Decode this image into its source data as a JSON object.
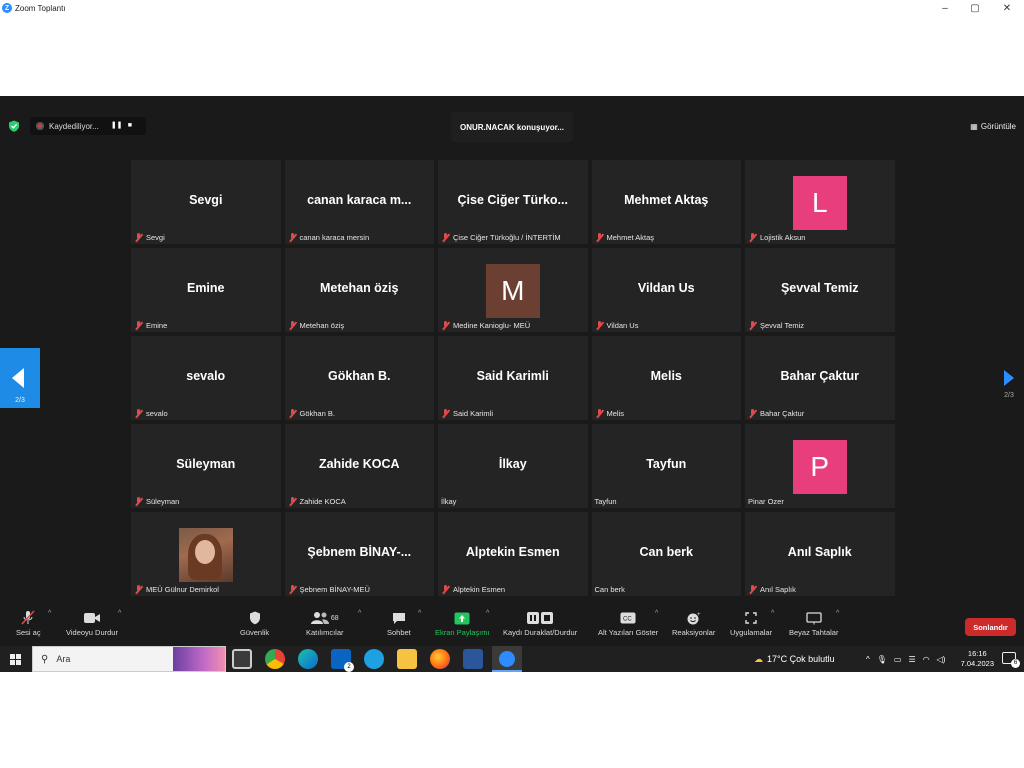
{
  "window": {
    "title": "Zoom Toplantı",
    "controls": [
      "–",
      "▢",
      "✕"
    ]
  },
  "topbar": {
    "recording_label": "Kaydediliyor...",
    "speaker": "ONUR.NACAK konuşuyor...",
    "view_label": "Görüntüle"
  },
  "pagination": {
    "prev_page_label": "2/3",
    "next_page_label": "2/3"
  },
  "participants": [
    {
      "display": "Sevgi",
      "label": "Sevgi",
      "muted": true
    },
    {
      "display": "canan karaca m...",
      "label": "canan karaca mersin",
      "muted": true
    },
    {
      "display": "Çise Ciğer Türko...",
      "label": "Çise Ciğer Türkoğlu / İNTERTİM",
      "muted": true
    },
    {
      "display": "Mehmet Aktaş",
      "label": "Mehmet Aktaş",
      "muted": true
    },
    {
      "display": "L",
      "avatar_color": "#e83e7d",
      "label": "Lojistik Aksun",
      "muted": true
    },
    {
      "display": "Emine",
      "label": "Emine",
      "muted": true
    },
    {
      "display": "Metehan öziş",
      "label": "Metehan öziş",
      "muted": true
    },
    {
      "display": "M",
      "avatar_color": "#6b3f31",
      "label": "Medine Kanioglu- MEÜ",
      "muted": true
    },
    {
      "display": "Vildan Us",
      "label": "Vildan Us",
      "muted": true
    },
    {
      "display": "Şevval Temiz",
      "label": "Şevval Temiz",
      "muted": true
    },
    {
      "display": "sevalo",
      "label": "sevalo",
      "muted": true
    },
    {
      "display": "Gökhan B.",
      "label": "Gökhan B.",
      "muted": true
    },
    {
      "display": "Said Karimli",
      "label": "Said Karimli",
      "muted": true
    },
    {
      "display": "Melis",
      "label": "Melis",
      "muted": true
    },
    {
      "display": "Bahar Çaktur",
      "label": "Bahar Çaktur",
      "muted": true
    },
    {
      "display": "Süleyman",
      "label": "Süleyman",
      "muted": true
    },
    {
      "display": "Zahide KOCA",
      "label": "Zahide KOCA",
      "muted": true
    },
    {
      "display": "İlkay",
      "label": "İlkay",
      "muted": false
    },
    {
      "display": "Tayfun",
      "label": "Tayfun",
      "muted": false
    },
    {
      "display": "P",
      "avatar_color": "#e83e7d",
      "label": "Pinar Ozer",
      "muted": false
    },
    {
      "photo": true,
      "display": "",
      "label": "MEÜ Gülnur Demirkol",
      "muted": true
    },
    {
      "display": "Şebnem BİNAY-...",
      "label": "Şebnem BİNAY-MEÜ",
      "muted": true
    },
    {
      "display": "Alptekin Esmen",
      "label": "Alptekin Esmen",
      "muted": true
    },
    {
      "display": "Can berk",
      "label": "Can berk",
      "muted": false
    },
    {
      "display": "Anıl Saplık",
      "label": "Anıl Saplık",
      "muted": true
    }
  ],
  "toolbar": {
    "unmute": "Sesi aç",
    "stop_video": "Videoyu Durdur",
    "security": "Güvenlik",
    "participants": "Katılımcılar",
    "participants_count": "68",
    "chat": "Sohbet",
    "share_screen": "Ekran Paylaşımı",
    "record_pause": "Kaydı Duraklat/Durdur",
    "captions": "Alt Yazıları Göster",
    "reactions": "Reaksiyonlar",
    "apps": "Uygulamalar",
    "whiteboard": "Beyaz Tahtalar",
    "end": "Sonlandır",
    "share_color": "#22c55e",
    "end_color": "#cc2b2b"
  },
  "taskbar": {
    "search_placeholder": "Ara",
    "weather": "17°C  Çok bulutlu",
    "time": "16:16",
    "date": "7.04.2023",
    "mail_badge": "2",
    "notification_count": "6"
  }
}
